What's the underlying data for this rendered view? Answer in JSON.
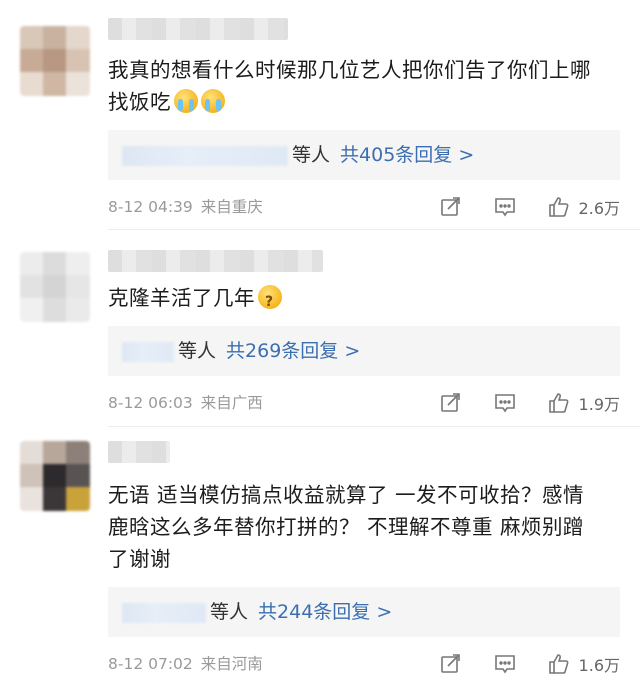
{
  "comments": [
    {
      "text": "我真的想看什么时候那几位艺人把你们告了你们上哪找饭吃",
      "reply_suffix": "等人",
      "reply_count": "共405条回复 >",
      "time": "8-12 04:39",
      "location": "来自重庆",
      "likes": "2.6万",
      "emoji": [
        "crying-face-icon",
        "crying-face-icon"
      ]
    },
    {
      "text": "克隆羊活了几年",
      "reply_suffix": "等人",
      "reply_count": "共269条回复 >",
      "time": "8-12 06:03",
      "location": "来自广西",
      "likes": "1.9万",
      "emoji": [
        "thinking-face-icon"
      ]
    },
    {
      "text": "无语 适当模仿搞点收益就算了 一发不可收拾？感情鹿晗这么多年替你打拼的？ 不理解不尊重 麻烦别蹭了谢谢",
      "reply_suffix": "等人",
      "reply_count": "共244条回复 >",
      "time": "8-12 07:02",
      "location": "来自河南",
      "likes": "1.6万",
      "emoji": []
    }
  ],
  "colors": {
    "link": "#3b6fb0",
    "meta": "#9a9a9a",
    "reply_bg": "#f5f5f5"
  }
}
